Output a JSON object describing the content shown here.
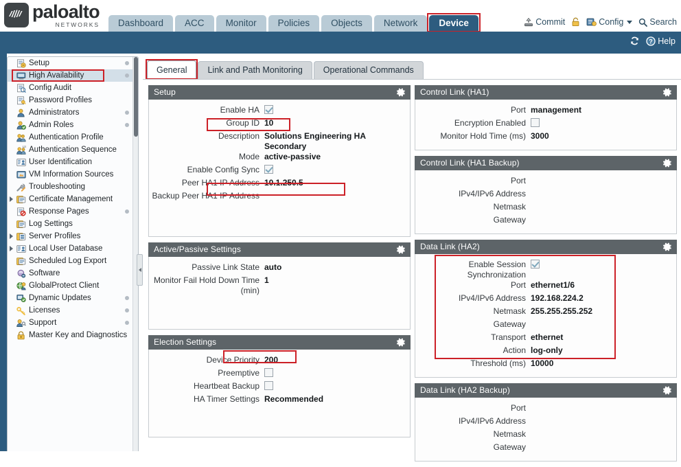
{
  "brand": {
    "name": "paloalto",
    "tagline": "NETWORKS",
    "reg": "®"
  },
  "nav": {
    "tabs": [
      {
        "label": "Dashboard",
        "active": false,
        "highlighted": false
      },
      {
        "label": "ACC",
        "active": false,
        "highlighted": false
      },
      {
        "label": "Monitor",
        "active": false,
        "highlighted": false
      },
      {
        "label": "Policies",
        "active": false,
        "highlighted": false
      },
      {
        "label": "Objects",
        "active": false,
        "highlighted": false
      },
      {
        "label": "Network",
        "active": false,
        "highlighted": false
      },
      {
        "label": "Device",
        "active": true,
        "highlighted": true
      }
    ]
  },
  "header_tools": {
    "commit": "Commit",
    "lock": "lock-icon",
    "config": "Config",
    "search": "Search"
  },
  "band_tools": {
    "refresh": "refresh-icon",
    "help": "Help"
  },
  "sidebar": {
    "items": [
      {
        "label": "Setup",
        "icon": "setup-icon",
        "expander": false,
        "dot": true,
        "selected": false,
        "highlighted": false
      },
      {
        "label": "High Availability",
        "icon": "high-availability-icon",
        "expander": false,
        "dot": true,
        "selected": true,
        "highlighted": true
      },
      {
        "label": "Config Audit",
        "icon": "config-audit-icon",
        "expander": false,
        "dot": false,
        "selected": false,
        "highlighted": false
      },
      {
        "label": "Password Profiles",
        "icon": "password-profiles-icon",
        "expander": false,
        "dot": false,
        "selected": false,
        "highlighted": false
      },
      {
        "label": "Administrators",
        "icon": "administrators-icon",
        "expander": false,
        "dot": true,
        "selected": false,
        "highlighted": false
      },
      {
        "label": "Admin Roles",
        "icon": "admin-roles-icon",
        "expander": false,
        "dot": true,
        "selected": false,
        "highlighted": false
      },
      {
        "label": "Authentication Profile",
        "icon": "authentication-profile-icon",
        "expander": false,
        "dot": false,
        "selected": false,
        "highlighted": false
      },
      {
        "label": "Authentication Sequence",
        "icon": "authentication-sequence-icon",
        "expander": false,
        "dot": false,
        "selected": false,
        "highlighted": false
      },
      {
        "label": "User Identification",
        "icon": "user-identification-icon",
        "expander": false,
        "dot": false,
        "selected": false,
        "highlighted": false
      },
      {
        "label": "VM Information Sources",
        "icon": "vm-information-sources-icon",
        "expander": false,
        "dot": false,
        "selected": false,
        "highlighted": false
      },
      {
        "label": "Troubleshooting",
        "icon": "troubleshooting-icon",
        "expander": false,
        "dot": false,
        "selected": false,
        "highlighted": false
      },
      {
        "label": "Certificate Management",
        "icon": "certificate-management-icon",
        "expander": true,
        "dot": false,
        "selected": false,
        "highlighted": false
      },
      {
        "label": "Response Pages",
        "icon": "response-pages-icon",
        "expander": false,
        "dot": true,
        "selected": false,
        "highlighted": false
      },
      {
        "label": "Log Settings",
        "icon": "log-settings-icon",
        "expander": false,
        "dot": false,
        "selected": false,
        "highlighted": false
      },
      {
        "label": "Server Profiles",
        "icon": "server-profiles-icon",
        "expander": true,
        "dot": false,
        "selected": false,
        "highlighted": false
      },
      {
        "label": "Local User Database",
        "icon": "local-user-database-icon",
        "expander": true,
        "dot": false,
        "selected": false,
        "highlighted": false
      },
      {
        "label": "Scheduled Log Export",
        "icon": "scheduled-log-export-icon",
        "expander": false,
        "dot": false,
        "selected": false,
        "highlighted": false
      },
      {
        "label": "Software",
        "icon": "software-icon",
        "expander": false,
        "dot": false,
        "selected": false,
        "highlighted": false
      },
      {
        "label": "GlobalProtect Client",
        "icon": "globalprotect-client-icon",
        "expander": false,
        "dot": false,
        "selected": false,
        "highlighted": false
      },
      {
        "label": "Dynamic Updates",
        "icon": "dynamic-updates-icon",
        "expander": false,
        "dot": true,
        "selected": false,
        "highlighted": false
      },
      {
        "label": "Licenses",
        "icon": "licenses-icon",
        "expander": false,
        "dot": true,
        "selected": false,
        "highlighted": false
      },
      {
        "label": "Support",
        "icon": "support-icon",
        "expander": false,
        "dot": true,
        "selected": false,
        "highlighted": false
      },
      {
        "label": "Master Key and Diagnostics",
        "icon": "master-key-icon",
        "expander": false,
        "dot": false,
        "selected": false,
        "highlighted": false
      }
    ]
  },
  "subtabs": [
    {
      "label": "General",
      "active": true,
      "highlighted": true
    },
    {
      "label": "Link and Path Monitoring",
      "active": false,
      "highlighted": false
    },
    {
      "label": "Operational Commands",
      "active": false,
      "highlighted": false
    }
  ],
  "panels": {
    "setup": {
      "title": "Setup",
      "rows": [
        {
          "key": "Enable HA",
          "type": "checkbox",
          "checked": true
        },
        {
          "key": "Group ID",
          "type": "text",
          "value": "10"
        },
        {
          "key": "Description",
          "type": "text",
          "value": "Solutions Engineering HA Secondary"
        },
        {
          "key": "Mode",
          "type": "text",
          "value": "active-passive"
        },
        {
          "key": "Enable Config Sync",
          "type": "checkbox",
          "checked": true
        },
        {
          "key": "Peer HA1 IP Address",
          "type": "text",
          "value": "10.1.250.5"
        },
        {
          "key": "Backup Peer HA1 IP Address",
          "type": "text",
          "value": ""
        }
      ]
    },
    "active_passive": {
      "title": "Active/Passive Settings",
      "rows": [
        {
          "key": "Passive Link State",
          "type": "text",
          "value": "auto"
        },
        {
          "key": "Monitor Fail Hold Down Time (min)",
          "type": "text",
          "value": "1"
        }
      ]
    },
    "election": {
      "title": "Election Settings",
      "rows": [
        {
          "key": "Device Priority",
          "type": "text",
          "value": "200"
        },
        {
          "key": "Preemptive",
          "type": "checkbox",
          "checked": false
        },
        {
          "key": "Heartbeat Backup",
          "type": "checkbox",
          "checked": false
        },
        {
          "key": "HA Timer Settings",
          "type": "text",
          "value": "Recommended"
        }
      ]
    },
    "control_ha1": {
      "title": "Control Link (HA1)",
      "rows": [
        {
          "key": "Port",
          "type": "text",
          "value": "management"
        },
        {
          "key": "Encryption Enabled",
          "type": "checkbox",
          "checked": false
        },
        {
          "key": "Monitor Hold Time (ms)",
          "type": "text",
          "value": "3000"
        }
      ]
    },
    "control_ha1_backup": {
      "title": "Control Link (HA1 Backup)",
      "rows": [
        {
          "key": "Port",
          "type": "text",
          "value": ""
        },
        {
          "key": "IPv4/IPv6 Address",
          "type": "text",
          "value": ""
        },
        {
          "key": "Netmask",
          "type": "text",
          "value": ""
        },
        {
          "key": "Gateway",
          "type": "text",
          "value": ""
        }
      ]
    },
    "data_ha2": {
      "title": "Data Link (HA2)",
      "rows": [
        {
          "key": "Enable Session Synchronization",
          "type": "checkbox",
          "checked": true
        },
        {
          "key": "Port",
          "type": "text",
          "value": "ethernet1/6"
        },
        {
          "key": "IPv4/IPv6 Address",
          "type": "text",
          "value": "192.168.224.2"
        },
        {
          "key": "Netmask",
          "type": "text",
          "value": "255.255.255.252"
        },
        {
          "key": "Gateway",
          "type": "text",
          "value": ""
        },
        {
          "key": "Transport",
          "type": "text",
          "value": "ethernet"
        },
        {
          "key": "Action",
          "type": "text",
          "value": "log-only"
        },
        {
          "key": "Threshold (ms)",
          "type": "text",
          "value": "10000"
        }
      ]
    },
    "data_ha2_backup": {
      "title": "Data Link (HA2 Backup)",
      "rows": [
        {
          "key": "Port",
          "type": "text",
          "value": ""
        },
        {
          "key": "IPv4/IPv6 Address",
          "type": "text",
          "value": ""
        },
        {
          "key": "Netmask",
          "type": "text",
          "value": ""
        },
        {
          "key": "Gateway",
          "type": "text",
          "value": ""
        }
      ]
    }
  },
  "colors": {
    "brand_blue": "#2d5c7f",
    "tab_inactive": "#b9cbd6",
    "panel_header": "#5d6468",
    "annotation_red": "#cc2027",
    "sidebar_selected": "#d3dfe8"
  }
}
